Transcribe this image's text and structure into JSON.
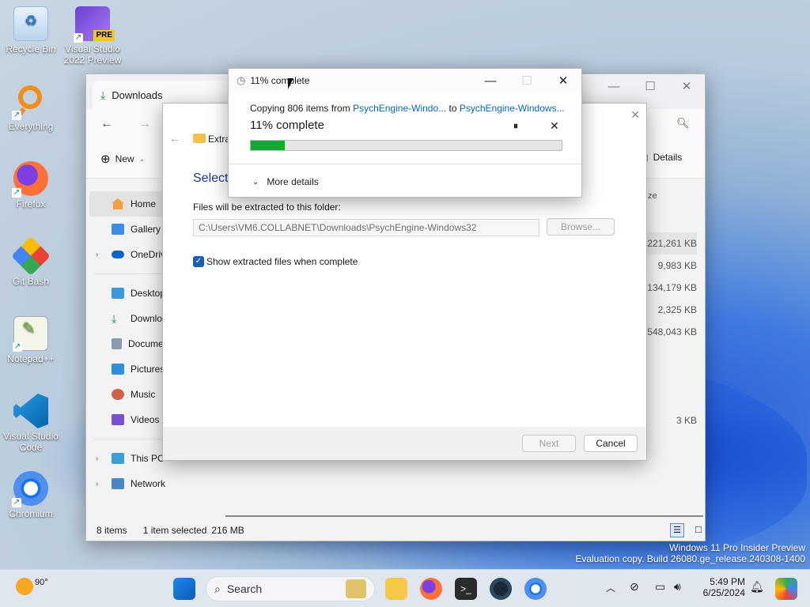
{
  "desktop": {
    "icons": [
      {
        "label": "Recycle Bin"
      },
      {
        "label": "Visual Studio 2022 Preview",
        "badge": "PRE"
      },
      {
        "label": "Everything"
      },
      {
        "label": "Firefox"
      },
      {
        "label": "Git Bash"
      },
      {
        "label": "Notepad++"
      },
      {
        "label": "Visual Studio Code"
      },
      {
        "label": "Chromium"
      }
    ],
    "watermark": {
      "line1": "Windows 11 Pro Insider Preview",
      "line2": "Evaluation copy. Build 26080.ge_release.240308-1400"
    }
  },
  "explorer": {
    "tab_title": "Downloads",
    "new_label": "New",
    "details_label": "Details",
    "size_header": "ze",
    "sidebar": [
      {
        "label": "Home",
        "icon": "home-icon",
        "selected": true
      },
      {
        "label": "Gallery",
        "icon": "gallery-icon"
      },
      {
        "label": "OneDriv",
        "icon": "cloud-icon"
      },
      {
        "label": "Desktop",
        "icon": "desktop-icon"
      },
      {
        "label": "Downlo",
        "icon": "download-icon"
      },
      {
        "label": "Docume",
        "icon": "document-icon"
      },
      {
        "label": "Pictures",
        "icon": "pictures-icon"
      },
      {
        "label": "Music",
        "icon": "music-icon"
      },
      {
        "label": "Videos",
        "icon": "videos-icon"
      },
      {
        "label": "This PC",
        "icon": "pc-icon"
      },
      {
        "label": "Network",
        "icon": "network-icon"
      }
    ],
    "sizes": [
      "221,261 KB",
      "9,983 KB",
      "134,179 KB",
      "2,325 KB",
      "548,043 KB",
      "",
      "",
      "",
      "3 KB"
    ],
    "status": {
      "items": "8 items",
      "selected": "1 item selected",
      "size": "216 MB"
    }
  },
  "extract_dialog": {
    "breadcrumb": "Extra",
    "heading": "Select",
    "folder_label": "Files will be extracted to this folder:",
    "path_value": "C:\\Users\\VM6.COLLABNET\\Downloads\\PsychEngine-Windows32",
    "browse_label": "Browse...",
    "checkbox_label": "Show extracted files when complete",
    "checkbox_checked": true,
    "next_label": "Next",
    "cancel_label": "Cancel"
  },
  "copy_dialog": {
    "title": "11% complete",
    "copying_prefix": "Copying 806 items from",
    "source": "PsychEngine-Windo...",
    "to_word": "to",
    "destination": "PsychEngine-Windows...",
    "status": "11% complete",
    "progress": 0.11,
    "more_details": "More details",
    "accent": "#06b025"
  },
  "taskbar": {
    "weather_temp": "90°",
    "search_label": "Search",
    "time": "5:49 PM",
    "date": "6/25/2024"
  }
}
